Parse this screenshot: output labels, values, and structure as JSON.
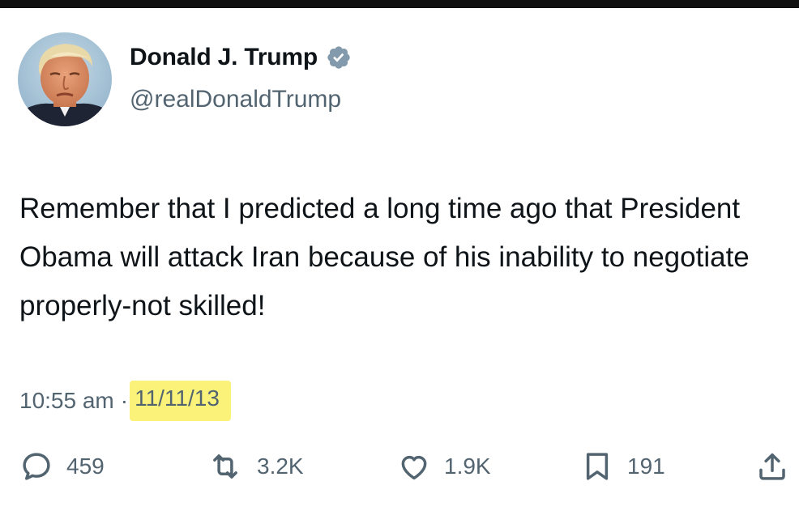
{
  "author": {
    "display_name": "Donald J. Trump",
    "handle": "@realDonaldTrump",
    "verified": true,
    "verified_icon": "verified-badge-icon",
    "avatar_icon": "profile-avatar"
  },
  "tweet": {
    "text": "Remember that I predicted a long time ago that President Obama will attack Iran because of his inability to negotiate properly-not skilled!",
    "time": "10:55 am",
    "separator": "·",
    "date": "11/11/13",
    "date_highlight_color": "#fbf27a"
  },
  "actions": {
    "reply": {
      "icon": "reply-icon",
      "count": "459"
    },
    "retweet": {
      "icon": "retweet-icon",
      "count": "3.2K"
    },
    "like": {
      "icon": "heart-icon",
      "count": "1.9K"
    },
    "bookmark": {
      "icon": "bookmark-icon",
      "count": "191"
    },
    "share": {
      "icon": "share-icon"
    }
  },
  "colors": {
    "text_primary": "#0f1419",
    "text_secondary": "#536471",
    "verified_badge": "#829aab",
    "top_bar": "#111111"
  }
}
